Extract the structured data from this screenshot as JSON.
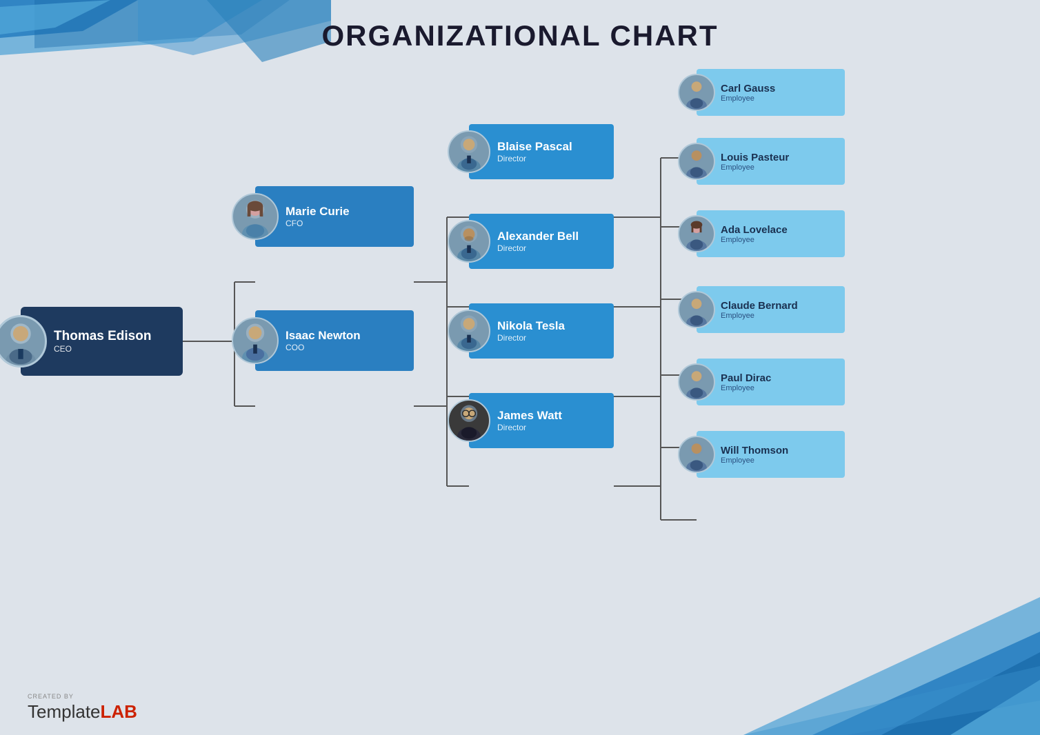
{
  "title": "ORGANIZATIONAL CHART",
  "logo": {
    "created_by": "CREATED BY",
    "brand": "Template",
    "brand_bold": "LAB"
  },
  "nodes": {
    "ceo": {
      "name": "Thomas Edison",
      "role": "CEO"
    },
    "cfo": {
      "name": "Marie Curie",
      "role": "CFO"
    },
    "coo": {
      "name": "Isaac Newton",
      "role": "COO"
    },
    "pascal": {
      "name": "Blaise Pascal",
      "role": "Director"
    },
    "bell": {
      "name": "Alexander Bell",
      "role": "Director"
    },
    "tesla": {
      "name": "Nikola Tesla",
      "role": "Director"
    },
    "watt": {
      "name": "James Watt",
      "role": "Director"
    },
    "gauss": {
      "name": "Carl Gauss",
      "role": "Employee"
    },
    "pasteur": {
      "name": "Louis Pasteur",
      "role": "Employee"
    },
    "lovelace": {
      "name": "Ada Lovelace",
      "role": "Employee"
    },
    "bernard": {
      "name": "Claude Bernard",
      "role": "Employee"
    },
    "dirac": {
      "name": "Paul Dirac",
      "role": "Employee"
    },
    "thomson": {
      "name": "Will Thomson",
      "role": "Employee"
    }
  },
  "colors": {
    "bg": "#dde3ea",
    "dark_card": "#1e3a5f",
    "blue_card": "#2a7fc1",
    "light_card": "#72c2e8",
    "emp_card": "#a8d8f0",
    "connector": "#555555"
  }
}
